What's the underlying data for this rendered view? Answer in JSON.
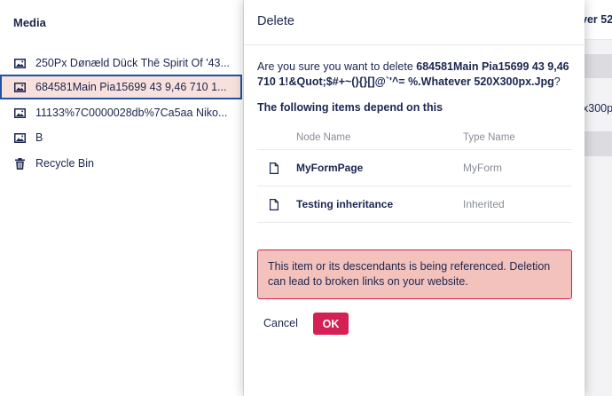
{
  "tree": {
    "title": "Media",
    "items": [
      {
        "label": "250Px Dønæld Dück Thē Spirit Of '43...",
        "icon": "image-icon"
      },
      {
        "label": "684581Main Pia15699 43 9,46 710 1...",
        "icon": "image-icon"
      },
      {
        "label": "11133%7C0000028db%7Ca5aa Niko...",
        "icon": "image-icon"
      },
      {
        "label": "B",
        "icon": "image-icon"
      },
      {
        "label": "Recycle Bin",
        "icon": "trash-icon"
      }
    ]
  },
  "background": {
    "header_text": "ver 52",
    "row_text": "x300p"
  },
  "dialog": {
    "title": "Delete",
    "question_prefix": "Are you sure you want to delete ",
    "item_name": "684581Main Pia15699 43 9,46 710 1!&Quot;$#+~(){}[]@`'^= %.Whatever 520X300px.Jpg",
    "question_suffix": "?",
    "dependents_title": "The following items depend on this",
    "columns": {
      "node_name": "Node Name",
      "type_name": "Type Name"
    },
    "rows": [
      {
        "name": "MyFormPage",
        "type": "MyForm",
        "icon": "document-icon"
      },
      {
        "name": "Testing inheritance",
        "type": "Inherited",
        "icon": "document-icon"
      }
    ],
    "warning": "This item or its descendants is being referenced. Deletion can lead to broken links on your website.",
    "cancel_label": "Cancel",
    "ok_label": "OK"
  },
  "colors": {
    "text": "#1b264f",
    "accent": "#d42054",
    "selected_bg": "#f8e1dd",
    "selected_border": "#2152a3",
    "warning_bg": "#f4c2bd",
    "muted": "#8a8d99"
  }
}
